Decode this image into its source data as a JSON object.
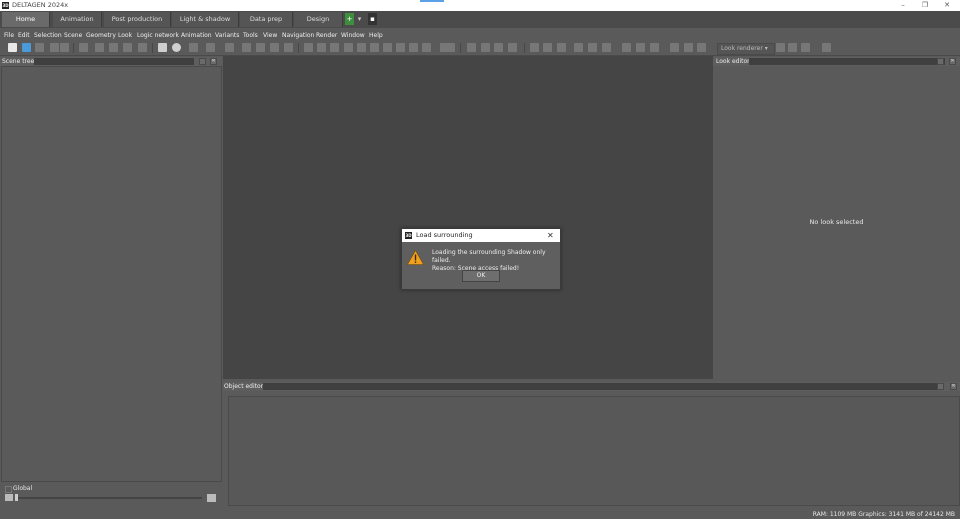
{
  "window": {
    "app_name": "DELTAGEN",
    "version": "2024x",
    "logo": "3D",
    "minimize": "–",
    "restore": "❐",
    "close": "✕"
  },
  "tabs": [
    {
      "label": "Home",
      "active": true
    },
    {
      "label": "Animation"
    },
    {
      "label": "Post production"
    },
    {
      "label": "Light & shadow"
    },
    {
      "label": "Data prep"
    },
    {
      "label": "Design"
    }
  ],
  "tab_actions": {
    "add": "+",
    "dropdown": "▾",
    "pin": "▪"
  },
  "menu": [
    "File",
    "Edit",
    "Selection",
    "Scene",
    "Geometry",
    "Look",
    "Logic network",
    "Animation",
    "Variants",
    "Tools",
    "View",
    "Navigation",
    "Render",
    "Window",
    "Help"
  ],
  "toolbar": {
    "look_renderer": "Look renderer"
  },
  "scene_tree": {
    "title": "Scene tree",
    "global_label": "Global"
  },
  "look_editor": {
    "title": "Look editor",
    "empty_text": "No look selected"
  },
  "object_editor": {
    "title": "Object editor"
  },
  "dialog": {
    "title": "Load surrounding",
    "logo": "3D",
    "line1": "Loading the surrounding Shadow only failed.",
    "line2": "Reason: Scene access failed!",
    "ok_label": "OK",
    "close": "✕",
    "icon": "warning-icon"
  },
  "status": {
    "ram": "RAM: 1109 MB",
    "graphics": "Graphics: 3141 MB of 24142 MB"
  },
  "colors": {
    "background": "#5a5a5a",
    "viewport": "#454545",
    "warning": "#f0a020"
  }
}
